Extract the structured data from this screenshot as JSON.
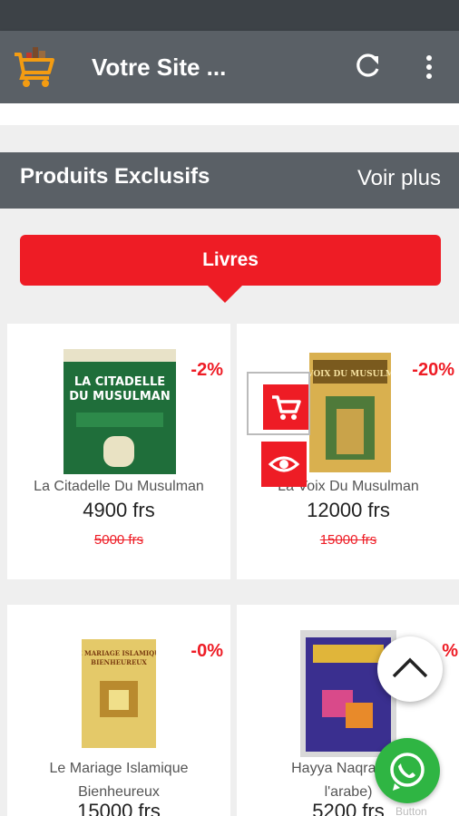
{
  "app_bar": {
    "title": "Votre Site ...",
    "logo_icon": "shopping-cart-logo-icon",
    "refresh_icon": "refresh-icon",
    "menu_icon": "more-vert-icon"
  },
  "section": {
    "title": "Produits Exclusifs",
    "see_more": "Voir plus"
  },
  "category": {
    "label": "Livres",
    "color": "#ee1c25"
  },
  "products": [
    {
      "name": "La Citadelle Du Musulman",
      "price": "4900 frs",
      "old_price": "5000 frs",
      "discount": "-2%",
      "cover_title": "LA CITADELLE DU MUSULMAN"
    },
    {
      "name": "La Voix Du Musulman",
      "price": "12000 frs",
      "old_price": "15000 frs",
      "discount": "-20%",
      "cover_title": "LA VOIX DU MUSULMAN"
    },
    {
      "name": "Le Mariage Islamique Bienheureux",
      "name_line1": "Le Mariage Islamique",
      "name_line2": "Bienheureux",
      "price": "15000 frs",
      "discount": "-0%",
      "cover_title": "LE MARIAGE ISLAMIQUE BIENHEUREUX"
    },
    {
      "name": "Hayya Naqra' (Ap... l'arabe)",
      "name_line1": "Hayya Naqra' (Ap",
      "name_line2": "l'arabe)",
      "price": "5200 frs",
      "discount": "%"
    }
  ],
  "quick_actions": {
    "cart_icon": "add-to-cart-icon",
    "view_icon": "eye-icon"
  },
  "floating": {
    "scroll_top_icon": "chevron-up-icon",
    "whatsapp_icon": "whatsapp-icon",
    "whatsapp_caption": "Button"
  },
  "colors": {
    "accent": "#ee1c25",
    "app_bar": "#5a6066",
    "status_bar": "#3d4247",
    "whatsapp": "#2fb543"
  }
}
